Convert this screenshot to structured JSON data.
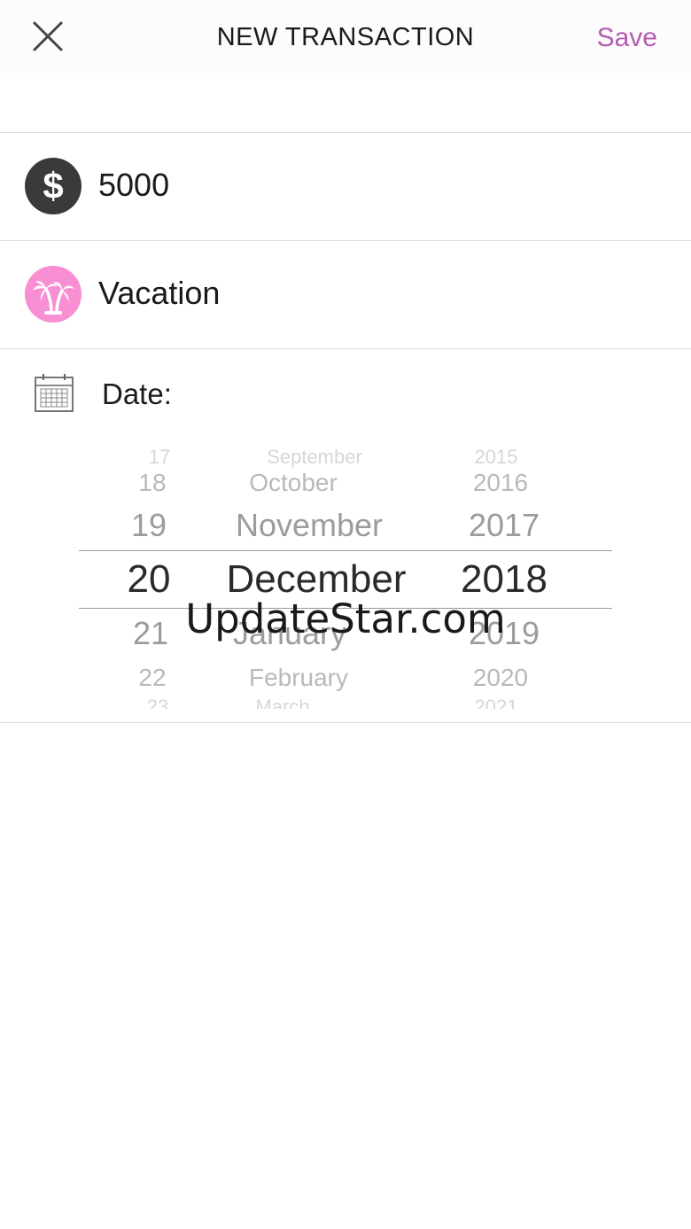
{
  "header": {
    "title": "NEW TRANSACTION",
    "save_label": "Save",
    "close_icon": "close-icon",
    "accent_color": "#b45cb0"
  },
  "amount": {
    "value": "5000",
    "icon": "dollar-icon",
    "icon_color": "#3a3a3a"
  },
  "category": {
    "label": "Vacation",
    "icon": "palm-trees-icon",
    "icon_color": "#f78fd2"
  },
  "date": {
    "label": "Date:",
    "icon": "calendar-icon",
    "picker": {
      "days": [
        "17",
        "18",
        "19",
        "20",
        "21",
        "22",
        "23"
      ],
      "months": [
        "September",
        "October",
        "November",
        "December",
        "January",
        "February",
        "March"
      ],
      "years": [
        "2015",
        "2016",
        "2017",
        "2018",
        "2019",
        "2020",
        "2021"
      ],
      "selected": {
        "day": "20",
        "month": "December",
        "year": "2018"
      }
    }
  },
  "watermark": "UpdateStar.com"
}
